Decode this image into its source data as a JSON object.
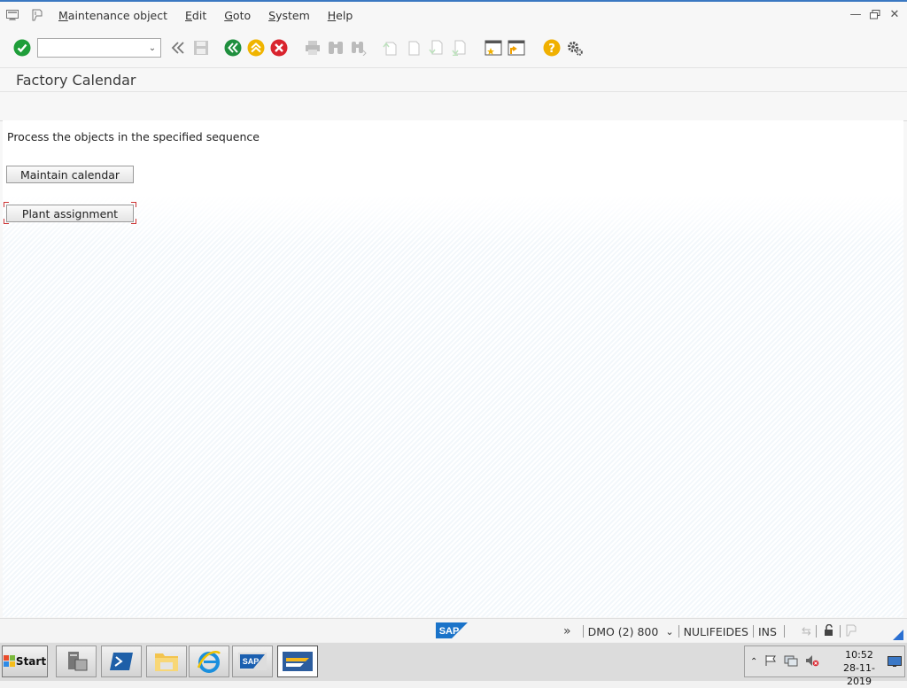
{
  "menubar": {
    "items": [
      {
        "label": "Maintenance object",
        "mnemonic": "M"
      },
      {
        "label": "Edit",
        "mnemonic": "E"
      },
      {
        "label": "Goto",
        "mnemonic": "G"
      },
      {
        "label": "System",
        "mnemonic": "S"
      },
      {
        "label": "Help",
        "mnemonic": "H"
      }
    ]
  },
  "toolbar": {
    "command_field_value": ""
  },
  "screen": {
    "title": "Factory Calendar",
    "instruction": "Process the objects in the specified sequence",
    "buttons": {
      "maintain": "Maintain calendar",
      "plant": "Plant assignment"
    }
  },
  "statusbar": {
    "system": "DMO (2) 800",
    "user": "NULIFEIDES",
    "mode": "INS",
    "logo_text": "SAP"
  },
  "taskbar": {
    "start_label": "Start",
    "time": "10:52",
    "date": "28-11-2019"
  },
  "colors": {
    "accept_green": "#1f9e3a",
    "back_green": "#1f8f3e",
    "exit_yellow": "#f0b400",
    "cancel_red": "#d9232d",
    "help_yellow": "#f0b000",
    "sap_blue": "#1a73c9"
  }
}
